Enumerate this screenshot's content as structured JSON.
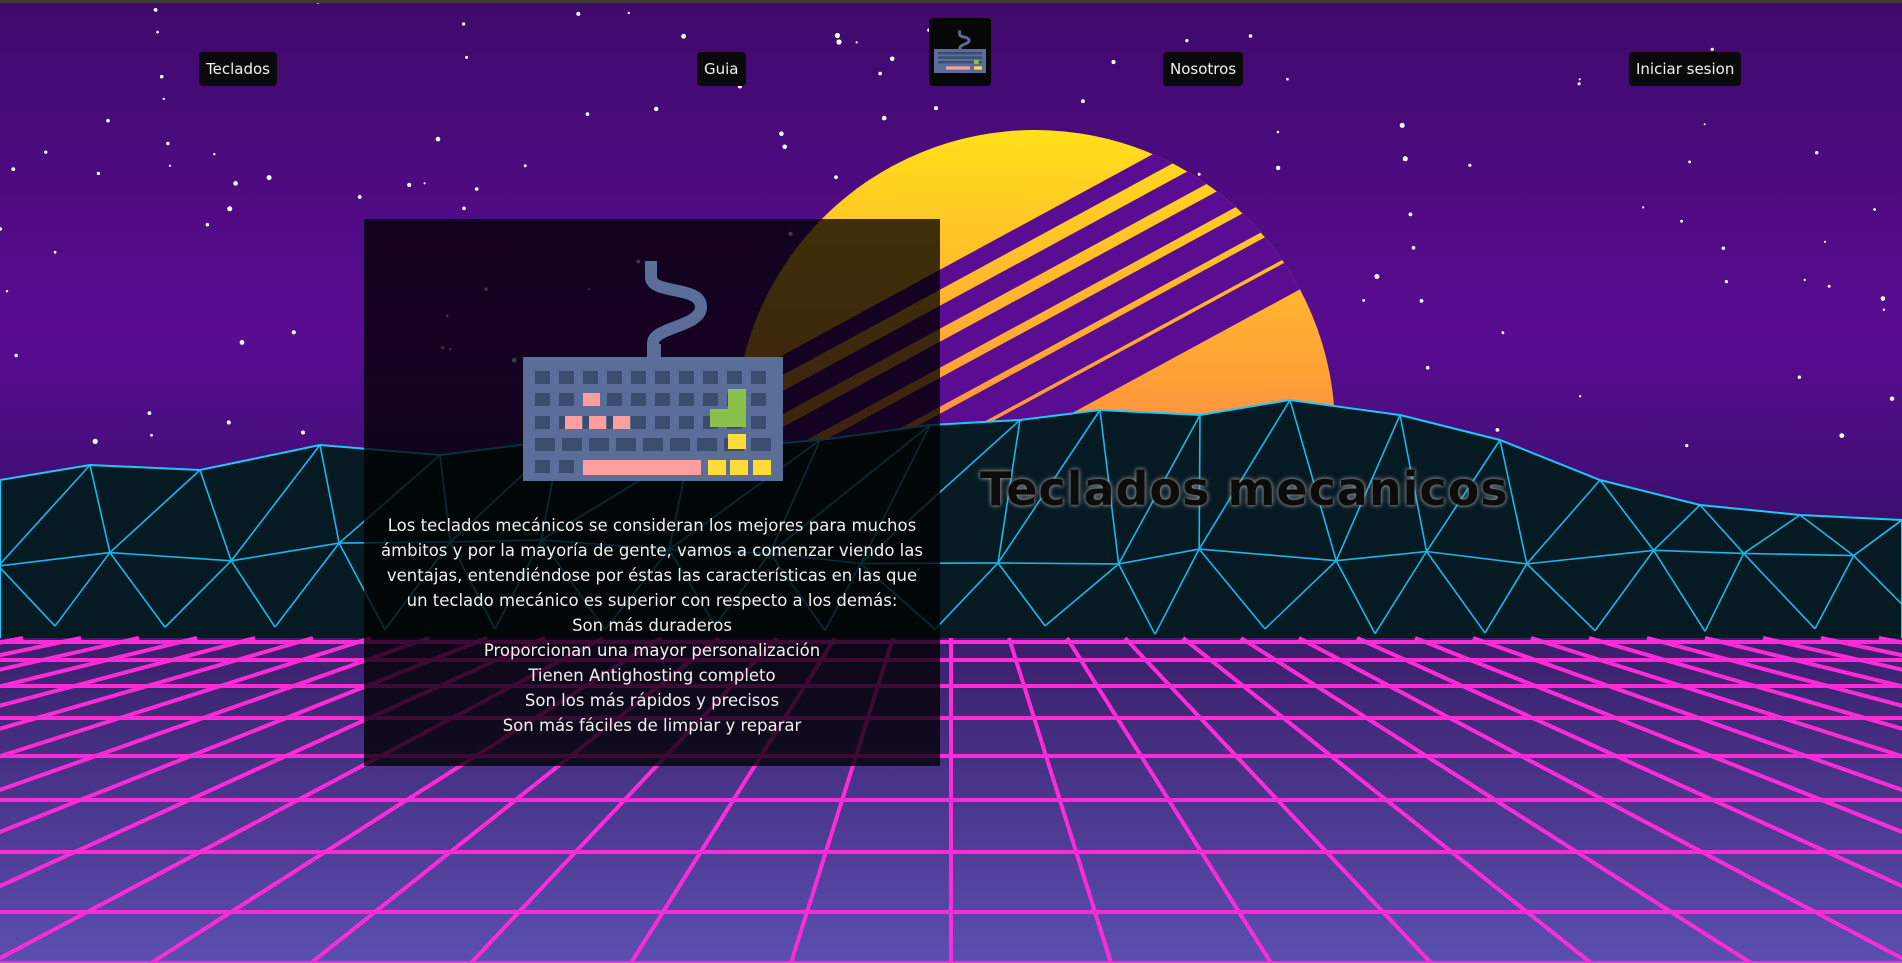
{
  "nav": {
    "teclados": "Teclados",
    "guia": "Guia",
    "nosotros": "Nosotros",
    "login": "Iniciar sesion"
  },
  "logo": {
    "icon": "keyboard-icon"
  },
  "card": {
    "intro_lines": [
      "Los teclados mecánicos se consideran los mejores para muchos",
      "ámbitos y por la mayoría de gente, vamos a comenzar viendo las",
      "ventajas, entendiéndose por éstas las características en las que",
      "un teclado mecánico es superior con respecto a los demás:"
    ],
    "advantages": [
      "Son más duraderos",
      "Proporcionan una mayor personalización",
      "Tienen Antighosting completo",
      "Son los más rápidos y precisos",
      "Son más fáciles de limpiar y reparar"
    ]
  },
  "hero": {
    "title": "Teclados mecanicos"
  },
  "colors": {
    "sky_top": "#4a0a7a",
    "sun_yellow": "#ffd21f",
    "sun_pink": "#ff4fa3",
    "mountain_cyan": "#1ec8ff",
    "grid_magenta": "#ff2bd6",
    "card_bg": "#000000",
    "nav_bg": "#0a0a0a"
  }
}
